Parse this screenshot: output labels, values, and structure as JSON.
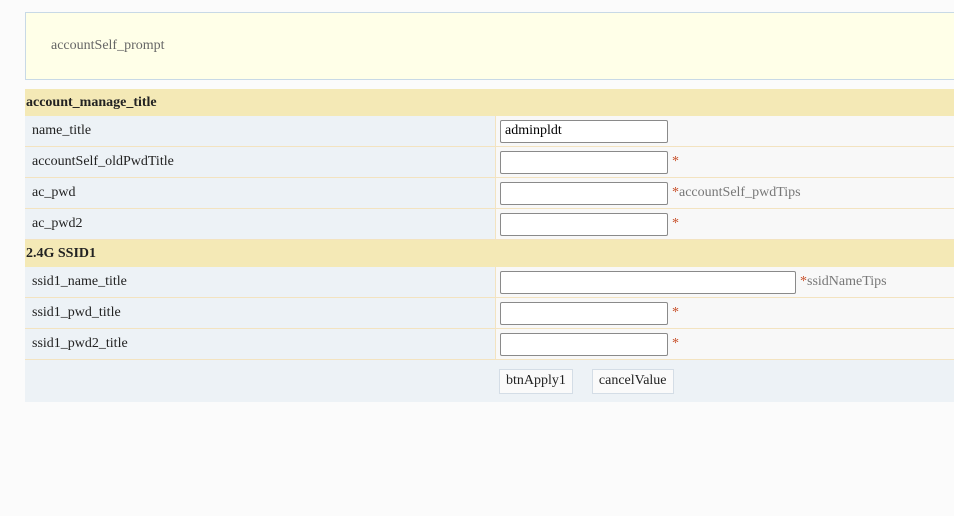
{
  "prompt": {
    "text": "accountSelf_prompt"
  },
  "account_section": {
    "title": "account_manage_title",
    "rows": [
      {
        "label": "name_title",
        "value": "adminpldt",
        "star": "",
        "tip": ""
      },
      {
        "label": "accountSelf_oldPwdTitle",
        "value": "",
        "star": "*",
        "tip": ""
      },
      {
        "label": "ac_pwd",
        "value": "",
        "star": "*",
        "tip": "accountSelf_pwdTips"
      },
      {
        "label": "ac_pwd2",
        "value": "",
        "star": "*",
        "tip": ""
      }
    ]
  },
  "ssid_section": {
    "title": "2.4G SSID1",
    "rows": [
      {
        "label": "ssid1_name_title",
        "value": "",
        "star": "*",
        "tip": "ssidNameTips"
      },
      {
        "label": "ssid1_pwd_title",
        "value": "",
        "star": "*",
        "tip": ""
      },
      {
        "label": "ssid1_pwd2_title",
        "value": "",
        "star": "*",
        "tip": ""
      }
    ]
  },
  "buttons": {
    "apply_label": "btnApply1",
    "cancel_label": "cancelValue"
  },
  "colors": {
    "section_header_bg": "#f4e9b6",
    "label_bg": "#edf2f6",
    "prompt_bg": "#ffffe8",
    "required_star": "#c8502a"
  }
}
